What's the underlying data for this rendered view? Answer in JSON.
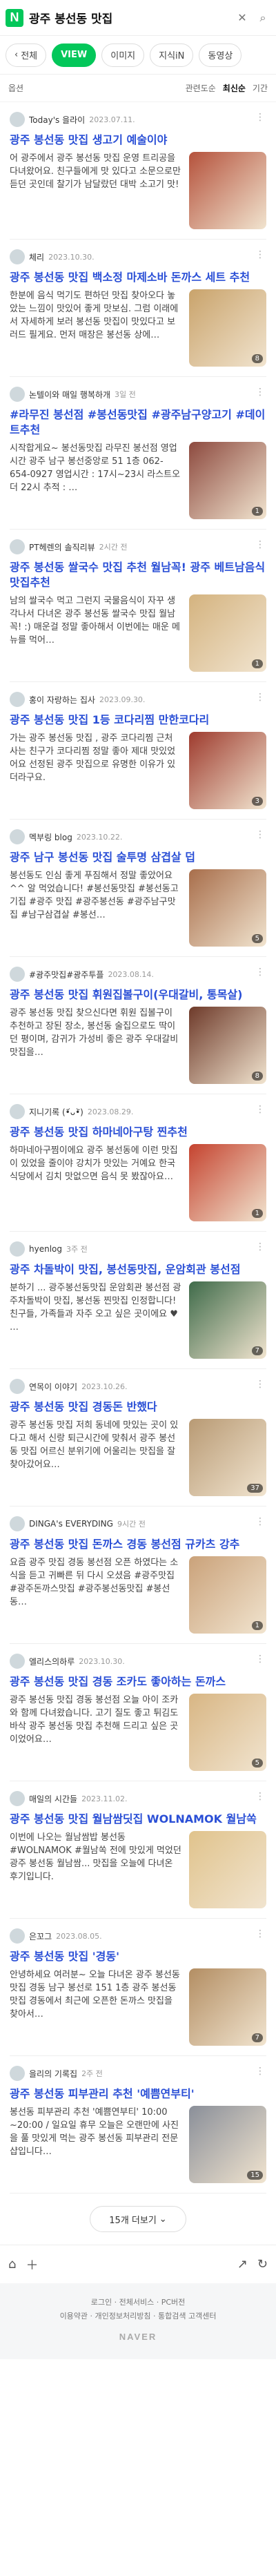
{
  "header": {
    "logo": "N",
    "query": "광주 봉선동 맛집"
  },
  "tabs": [
    {
      "label": "전체"
    },
    {
      "label": "VIEW"
    },
    {
      "label": "이미지"
    },
    {
      "label": "지식iN"
    },
    {
      "label": "동영상"
    }
  ],
  "options": {
    "label": "옵션",
    "sorts": [
      "관련도순",
      "최신순"
    ],
    "extra": "기간"
  },
  "posts": [
    {
      "author": "Today's 을라이",
      "date": "2023.07.11.",
      "title": "광주 봉선동 맛집 생고기 예술이야",
      "snippet": "어 광주에서 광주 봉선동 맛집 운영 트리공을 다녀왔어요. 친구들에게 맛 있다고 소문으로만 듣던 곳인데 찰기가 남달랐던 대박 소고기 맛!",
      "thumb": "#b5523c",
      "count": ""
    },
    {
      "author": "체리",
      "date": "2023.10.30.",
      "title": "광주 봉선동 맛집 백소정 마제소바 돈까스 세트 추천",
      "snippet": "한분에 음식 먹기도 편하던 맛집 찾아오다 놓았는 느낌이 맛있어 좋게 맛보심. 그럼 이래에서 자세하게 보러 봉선동 맛집이 맛있다고 보러드 필게요. 먼저 매장은 봉선동 상에…",
      "thumb": "#c9a36b",
      "count": "8"
    },
    {
      "author": "논텔이와 매일 행복하개",
      "date": "3일 전",
      "title": "#라무진 봉선점 #봉선동맛집 #광주남구양고기 #데이트추천",
      "snippet": "시작합게요~ 봉선동맛집 라무진 봉선점 영업시간 광주 남구 봉선중앙로 51 1층 062-654-0927 영업시간 : 17시~23시 라스트오더 22시 추적 : …",
      "thumb": "#8d4a3f",
      "count": "1"
    },
    {
      "author": "PT헤렌의 솔직리뷰",
      "date": "2시간 전",
      "title": "광주 봉선동 쌀국수 맛집 추천 월남꼭! 광주 베트남음식 맛집추천",
      "snippet": "남의 쌀국수 먹고 그런지 국물음식이 자꾸 생각나서 다녀온 광주 봉선동 쌀국수 맛집 월남꼭! :) 매운걸 정말 좋아해서 이번에는 매운 메뉴를 먹어…",
      "thumb": "#d4b37f",
      "count": "1"
    },
    {
      "author": "홍이 자랑하는 집사",
      "date": "2023.09.30.",
      "title": "광주 봉선동 맛집 1등 코다리찜 만한코다리",
      "snippet": "가는 광주 봉선동 맛집 , 광주 코다리찜 근처 사는 친구가 코다리찜 정말 좋아 제대 맛있었어요 선정된 광주 맛집으로 유명한 이유가 있더라구요.",
      "thumb": "#9e3b2e",
      "count": "3"
    },
    {
      "author": "멕부링 blog",
      "date": "2023.10.22.",
      "title": "광주 남구 봉선동 맛집 술투명 삼겹살 덥",
      "snippet": "봉선동도 인심 좋게 푸짐해서 정말 좋았어요^^ 알 먹었습니다! #봉선동맛집 #봉선동고기집 #광주 맛집 #광주봉선동 #광주남구맛집 #남구삼겹살 #봉선…",
      "thumb": "#a86e4b",
      "count": "5"
    },
    {
      "author": "#광주맛집#광주투플",
      "date": "2023.08.14.",
      "title": "광주 봉선동 맛집 휘원집볼구이(우대갈비, 통목살)",
      "snippet": "광주 봉선동 맛집 찾으신다면 휘원 집볼구이 추천하고 장된 장소, 봉선동 술집으로도 딱이던 평이며, 감귀가 가성비 좋은 광주 우대갈비 맛집을…",
      "thumb": "#6e3a2a",
      "count": "8"
    },
    {
      "author": "지니기록 (•᷄ᴗ•᷅)",
      "date": "2023.08.29.",
      "title": "광주 봉선동 맛집 하마네아구탕 찐추천",
      "snippet": "하마네아구찜이에요 광주 봉선동에 이런 맛집이 있었을 줄이야 강치가 맛있는 거예요 한국 식당에서 김치 맛없으면 음식 못 봤잖아요…",
      "thumb": "#c5432f",
      "count": "1"
    },
    {
      "author": "hyenlog",
      "date": "3주 전",
      "title": "광주 차돌박이 맛집, 봉선동맛집, 운암회관 봉선점",
      "snippet": "분하기 ... 광주봉선동맛집 운암회관 봉선점 광주차돌박이 맛집, 봉선동 찐맛집 인정합니다! 친구들, 가족들과 자주 오고 싶은 곳이에요 ♥ …",
      "thumb": "#3f6b4a",
      "count": "7"
    },
    {
      "author": "연목이 이야기",
      "date": "2023.10.26.",
      "title": "광주 봉선동 맛집 경동돈 반했다",
      "snippet": "광주 봉선동 맛집 저희 동네에 맛있는 곳이 있다고 해서 신랑 퇴근시간에 맞춰서 광주 봉선동 맛집 어르신 분위기에 어울리는 맛집을 잘 찾아갔어요…",
      "thumb": "#b89a74",
      "count": "37"
    },
    {
      "author": "DINGA's EVERYDING",
      "date": "9시간 전",
      "title": "광주 봉선동 맛집 돈까스 경동 봉선점 규카츠 강추",
      "snippet": "요즘 광주 맛집 경동 봉선점 오픈 하였다는 소식을 듣고 귀빠른 뒤 다시 오셨음 #광주맛집 #광주돈까스맛집 #광주봉선동맛집 #봉선동…",
      "thumb": "#caa27a",
      "count": "1"
    },
    {
      "author": "엘리스의하루",
      "date": "2023.10.30.",
      "title": "광주 봉선동 맛집 경동 조카도 좋아하는 돈까스",
      "snippet": "광주 봉선동 맛집 경동 봉선점 오늘 아이 조카와 함께 다녀왔습니다. 고기 질도 좋고 튀김도 바삭 광주 봉선동 맛집 추천해 드리고 싶은 곳이었어요…",
      "thumb": "#d8b684",
      "count": "5"
    },
    {
      "author": "매일의 시간들",
      "date": "2023.11.02.",
      "title": "광주 봉선동 맛집 월남쌈딧집 WOLNAMOK 월남쏙",
      "snippet": "이번에 나오는 월남쌈밥 봉선동 #WOLNAMOK #월남쏙 전에 맛있게 먹었던 광주 봉선동 월남쌈... 맛집을 오늘에 다녀온 후기입니다.",
      "thumb": "#e0c38c",
      "count": ""
    },
    {
      "author": "은꼬그",
      "date": "2023.08.05.",
      "title": "광주 봉선동 맛집 '경동'",
      "snippet": "안녕하세요 여러분~ 오늘 다녀온 광주 봉선동 맛집 경동 남구 봉선로 151 1층 광주 봉선동 맛집 경동에서 최근에 오픈한 돈까스 맛집을 찾아서…",
      "thumb": "#b38e63",
      "count": "7"
    },
    {
      "author": "을리의 기록집",
      "date": "2주 전",
      "title": "광주 봉선동 피부관리 추천 '예쁨연부티'",
      "snippet": "봉선동 피부관리 추천 '예쁨연부티' 10:00 ~20:00 / 일요일 휴무 오늘은 오랜만에 사진을 풀 맛있게 먹는 광주 봉선동 피부관리 전문 샵입니다…",
      "thumb": "#8a8f99",
      "count": "15"
    }
  ],
  "more_button": "15개 더보기",
  "footer": {
    "line1": "로그인 · 전체서비스 · PC버전",
    "line2": "이용약관 · 개인정보처리방침 · 통합검색 고객센터",
    "brand": "NAVER"
  }
}
